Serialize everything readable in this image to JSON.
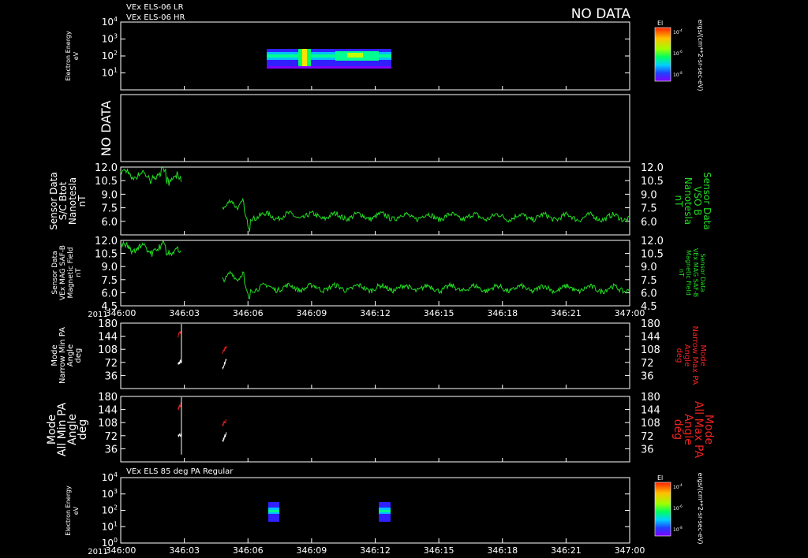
{
  "header": {
    "line1": "VEx ELS-06 LR",
    "line2": "VEx ELS-06 HR",
    "nodata_top": "NO DATA"
  },
  "colorbar_unit": "ergs/(cm**2-sr-sec-eV)",
  "colors": {
    "green": "#22dd22",
    "red": "#ee2222",
    "white": "#ffffff",
    "background": "#000000",
    "axis": "#ffffff"
  },
  "chart_data": [
    {
      "type": "heatmap",
      "id": "panel1",
      "ylabel_lines": [
        "Electron Energy",
        "eV"
      ],
      "ytick_labels": [
        "10",
        "10",
        "10",
        "10"
      ],
      "ytick_exponents": [
        "4",
        "3",
        "2",
        "1"
      ],
      "yscale": "log",
      "ylim": [
        1,
        10000
      ],
      "data_extent": {
        "x": [
          "346:06.7",
          "346:12.4"
        ],
        "y_eV": [
          5,
          300
        ]
      },
      "colorbar": {
        "label": "El",
        "ticks": [
          "10",
          "10",
          "10"
        ],
        "tick_exponents": [
          "-4",
          "-6",
          "-8"
        ]
      }
    },
    {
      "type": "line",
      "id": "panel2",
      "nodata_label": "NO DATA"
    },
    {
      "type": "line",
      "id": "panel3",
      "ylabel_left": [
        "Sensor Data",
        "S/C Btot",
        "Nanotesla",
        "nT"
      ],
      "ylabel_right": [
        "Sensor Data",
        "VSO B",
        "Nanotesla",
        "nT"
      ],
      "ytick_labels": [
        "12.0",
        "10.5",
        "9.0",
        "7.5",
        "6.0"
      ],
      "ylim": [
        4.5,
        12.0
      ],
      "series": [
        {
          "segment": 1,
          "x_min": [
            0,
            7.2
          ],
          "y_nT": [
            11.5,
            10.6
          ]
        },
        {
          "segment": 2,
          "x_min": [
            12.0,
            60.0
          ],
          "y_nT": [
            7.8,
            6.4
          ]
        }
      ]
    },
    {
      "type": "line",
      "id": "panel4",
      "ylabel_left": [
        "Sensor Data",
        "VEx MAG SAF-B",
        "Magnetic Field",
        "nT"
      ],
      "ylabel_right": [
        "Sensor Data",
        "VEx MAG SAF-B",
        "Magnetic Field",
        "nT"
      ],
      "ytick_labels": [
        "12.0",
        "10.5",
        "9.0",
        "7.5",
        "6.0",
        "4.5"
      ],
      "ylim": [
        4.5,
        12.0
      ],
      "xaxis_year": "2011",
      "xtick_labels": [
        "346:00",
        "346:03",
        "346:06",
        "346:09",
        "346:12",
        "346:15",
        "346:18",
        "346:21",
        "347:00"
      ]
    },
    {
      "type": "line",
      "id": "panel5",
      "ylabel_left": [
        "Mode",
        "Narrow Min PA",
        "Angle",
        "deg"
      ],
      "ylabel_right": [
        "Mode",
        "Narrow Max PA",
        "Angle",
        "deg"
      ],
      "ytick_labels": [
        "180",
        "144",
        "108",
        "72",
        "36"
      ],
      "ylim": [
        0,
        180
      ],
      "series": [
        {
          "name": "max",
          "color": "red"
        },
        {
          "name": "min",
          "color": "white"
        }
      ]
    },
    {
      "type": "line",
      "id": "panel6",
      "ylabel_left": [
        "Mode",
        "All Min PA",
        "Angle",
        "deg"
      ],
      "ylabel_right": [
        "Mode",
        "All Max PA",
        "Angle",
        "deg"
      ],
      "ytick_labels": [
        "180",
        "144",
        "108",
        "72",
        "36"
      ],
      "ylim": [
        0,
        180
      ]
    },
    {
      "type": "heatmap",
      "id": "panel7",
      "title": "VEx ELS 85 deg PA Regular",
      "ylabel_lines": [
        "Electron Energy",
        "eV"
      ],
      "ytick_labels": [
        "10",
        "10",
        "10",
        "10",
        "10"
      ],
      "ytick_exponents": [
        "4",
        "3",
        "2",
        "1",
        "0"
      ],
      "yscale": "log",
      "ylim": [
        1,
        10000
      ],
      "xaxis_year": "2011",
      "xtick_labels": [
        "346:00",
        "346:03",
        "346:06",
        "346:09",
        "346:12",
        "346:15",
        "346:18",
        "346:21",
        "347:00"
      ],
      "colorbar": {
        "label": "El",
        "ticks": [
          "10",
          "10",
          "10"
        ],
        "tick_exponents": [
          "-4",
          "-6",
          "-8"
        ]
      }
    }
  ]
}
